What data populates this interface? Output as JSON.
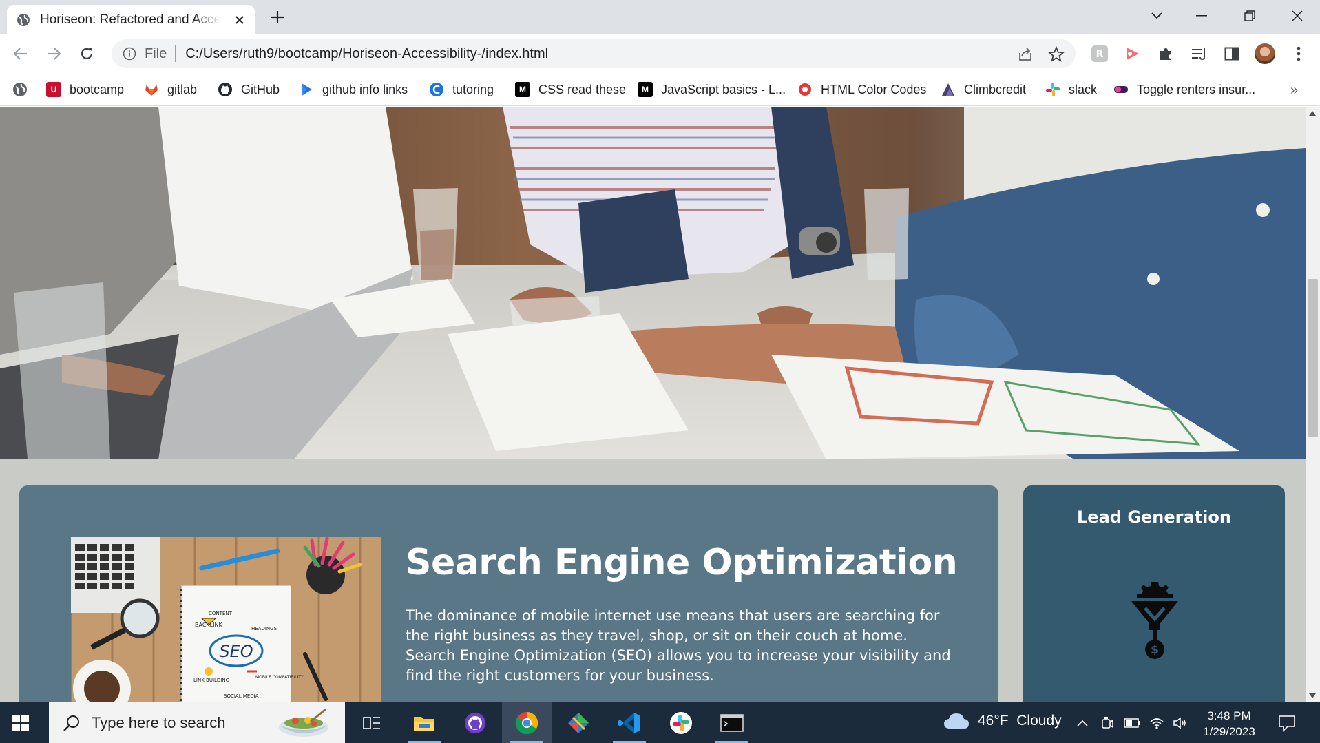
{
  "browser": {
    "tab_title": "Horiseon: Refactored and Accessible",
    "url_scheme": "File",
    "url": "C:/Users/ruth9/bootcamp/Horiseon-Accessibility-/index.html"
  },
  "bookmarks": [
    {
      "label": "",
      "icon": "globe-icon"
    },
    {
      "label": "bootcamp",
      "icon": "bootcamp-icon"
    },
    {
      "label": "gitlab",
      "icon": "gitlab-icon"
    },
    {
      "label": "GitHub",
      "icon": "github-icon"
    },
    {
      "label": "github info links",
      "icon": "play-icon"
    },
    {
      "label": "tutoring",
      "icon": "tutoring-icon"
    },
    {
      "label": "CSS read these",
      "icon": "medium-icon"
    },
    {
      "label": "JavaScript basics - L...",
      "icon": "medium-icon"
    },
    {
      "label": "HTML Color Codes",
      "icon": "color-icon"
    },
    {
      "label": "Climbcredit",
      "icon": "climb-icon"
    },
    {
      "label": "slack",
      "icon": "slack-icon"
    },
    {
      "label": "Toggle renters insur...",
      "icon": "toggle-icon"
    }
  ],
  "bookmarks_overflow": "»",
  "page": {
    "seo": {
      "heading": "Search Engine Optimization",
      "body": "The dominance of mobile internet use means that users are searching for the right business as they travel, shop, or sit on their couch at home. Search Engine Optimization (SEO) allows you to increase your visibility and find the right customers for your business.",
      "image_words": [
        "CONTENT",
        "BACKLINK",
        "HEADINGS",
        "SEO",
        "LINK BUILDING",
        "MOBILE COMPATIBILITY",
        "SOCIAL MEDIA"
      ]
    },
    "lead": {
      "title": "Lead Generation"
    }
  },
  "taskbar": {
    "search_placeholder": "Type here to search",
    "weather": "46°F  Cloudy",
    "time": "3:48 PM",
    "date": "1/29/2023"
  },
  "colors": {
    "seo_card": "#5a7787",
    "lead_card": "#345a6f",
    "page_bg": "#c9ccc6",
    "taskbar": "#1b2b3c"
  }
}
